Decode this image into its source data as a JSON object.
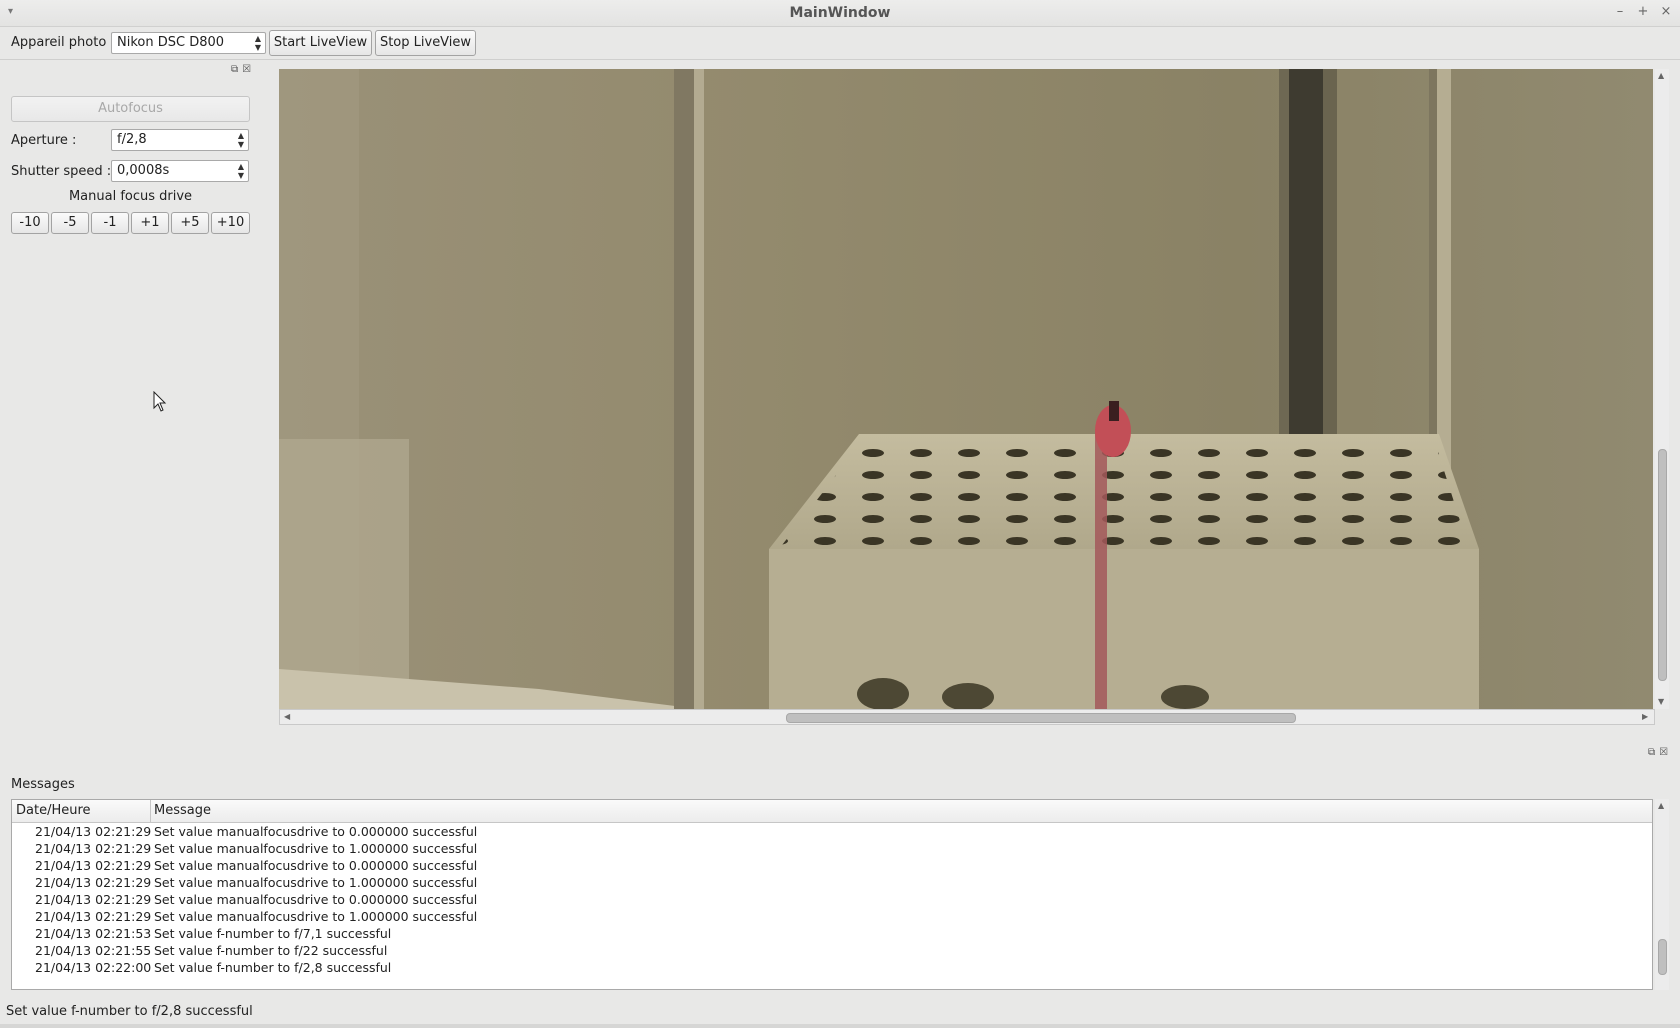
{
  "window": {
    "title": "MainWindow",
    "menu_icon": "window-menu-arrow-icon",
    "controls": [
      "minimize-icon",
      "maximize-icon",
      "close-icon"
    ]
  },
  "toolbar": {
    "camera_label": "Appareil photo :",
    "camera_value": "Nikon DSC D800",
    "start_liveview": "Start LiveView",
    "stop_liveview": "Stop LiveView"
  },
  "controls": {
    "autofocus": "Autofocus",
    "aperture_label": "Aperture :",
    "aperture_value": "f/2,8",
    "shutter_label": "Shutter speed :",
    "shutter_value": "0,0008s",
    "manual_focus_title": "Manual focus drive",
    "focus_buttons": [
      "-10",
      "-5",
      "-1",
      "+1",
      "+5",
      "+10"
    ]
  },
  "messages": {
    "title": "Messages",
    "columns": [
      "Date/Heure",
      "Message"
    ],
    "rows": [
      {
        "date": "21/04/13 02:21:29",
        "message": "Set value manualfocusdrive to 0.000000 successful"
      },
      {
        "date": "21/04/13 02:21:29",
        "message": "Set value manualfocusdrive to 1.000000 successful"
      },
      {
        "date": "21/04/13 02:21:29",
        "message": "Set value manualfocusdrive to 0.000000 successful"
      },
      {
        "date": "21/04/13 02:21:29",
        "message": "Set value manualfocusdrive to 1.000000 successful"
      },
      {
        "date": "21/04/13 02:21:29",
        "message": "Set value manualfocusdrive to 0.000000 successful"
      },
      {
        "date": "21/04/13 02:21:29",
        "message": "Set value manualfocusdrive to 1.000000 successful"
      },
      {
        "date": "21/04/13 02:21:53",
        "message": "Set value f-number to f/7,1 successful"
      },
      {
        "date": "21/04/13 02:21:55",
        "message": "Set value f-number to f/22 successful"
      },
      {
        "date": "21/04/13 02:22:00",
        "message": "Set value f-number to f/2,8 successful"
      }
    ]
  },
  "status_bar": "Set value f-number to f/2,8 successful"
}
